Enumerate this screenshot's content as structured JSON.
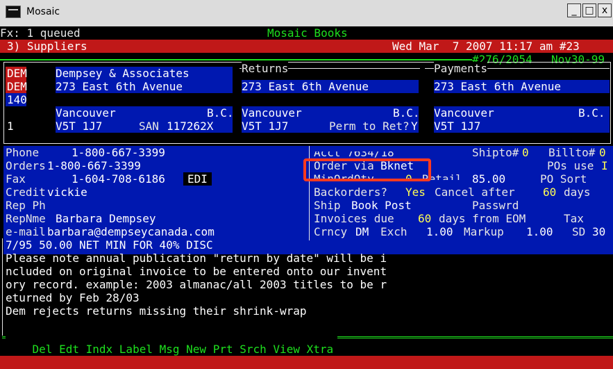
{
  "window": {
    "title": "Mosaic",
    "minimize": "_",
    "maximize": "□",
    "close": "x"
  },
  "header": {
    "queue": "Fx: 1 queued",
    "app_name": "Mosaic Books",
    "menu_item": "3) Suppliers",
    "datetime": "Wed Mar  7 2007 11:17 am #23",
    "record_id": "#276/2054",
    "record_date": "Nov30-99"
  },
  "supplier": {
    "code1": "DEM",
    "code2": "DEM",
    "code3": "140",
    "code4": "1",
    "name": "Dempsey & Associates",
    "address": "273 East 6th Avenue",
    "city": "Vancouver",
    "province": "B.C.",
    "postal": "V5T 1J7",
    "san_label": "SAN",
    "san": "117262X"
  },
  "returns": {
    "label": "Returns",
    "address": "273 East 6th Avenue",
    "city": "Vancouver",
    "province": "B.C.",
    "postal": "V5T 1J7",
    "perm_label": "Perm to Ret?",
    "perm_value": "Y"
  },
  "payments": {
    "label": "Payments",
    "address": "273 East 6th Avenue",
    "city": "Vancouver",
    "province": "B.C.",
    "postal": "V5T 1J7"
  },
  "contact": {
    "phone_label": "Phone",
    "phone": "1-800-667-3399",
    "orders_label": "Orders",
    "orders": "1-800-667-3399",
    "fax_label": "Fax",
    "fax": "1-604-708-6186",
    "edi": "EDI",
    "credit_label": "Credit",
    "credit": "vickie",
    "rep_ph_label": "Rep Ph",
    "rep_name_label": "RepNme",
    "rep_name": "Barbara Dempsey",
    "email_label": "e-mail",
    "email": "barbara@dempseycanada.com"
  },
  "terms": {
    "acct_partial": "Acct 7634/18",
    "shipto_label": "Shipto#",
    "shipto": "0",
    "billto_label": "Billto#",
    "billto": "0",
    "order_via_label": "Order via",
    "order_via": "Bknet",
    "pos_use_label": "POs use",
    "pos_use": "I",
    "minordqty_label": "MinOrdQty",
    "minordqty": "0",
    "retail_label": "Retail",
    "retail": "85.00",
    "po_sort_label": "PO Sort",
    "backorders_label": "Backorders?",
    "backorders": "Yes",
    "cancel_after_label": "Cancel after",
    "cancel_days": "60",
    "cancel_unit": "days",
    "ship_label": "Ship",
    "ship": "Book Post",
    "password_label": "Passwrd",
    "invoices_label": "Invoices due",
    "invoices_days": "60",
    "invoices_suffix": "days from EOM",
    "tax_label": "Tax",
    "currency_label": "Crncy",
    "currency": "DM",
    "exch_label": "Exch",
    "exch": "1.00",
    "markup_label": "Markup",
    "markup": "1.00",
    "sd_label": "SD",
    "sd": "30"
  },
  "notes": {
    "discount_line": "7/95 50.00 NET MIN FOR 40% DISC",
    "lines": [
      "Please note annual publication \"return by date\" will be i",
      "ncluded on original invoice to be entered onto our invent",
      "ory record. example: 2003 almanac/all 2003 titles to be r",
      "eturned by Feb 28/03",
      "Dem rejects returns missing their shrink-wrap"
    ]
  },
  "commands": [
    "Del",
    "Edt",
    "Indx",
    "Label",
    "Msg",
    "New",
    "Prt",
    "Srch",
    "View",
    "Xtra"
  ],
  "colors": {
    "terminal_bg": "#000000",
    "field_bg": "#0018b0",
    "header_bg": "#c01818",
    "label_text": "#e6e6e6",
    "accent_green": "#1ee01e",
    "highlight": "#ff3a1f"
  }
}
